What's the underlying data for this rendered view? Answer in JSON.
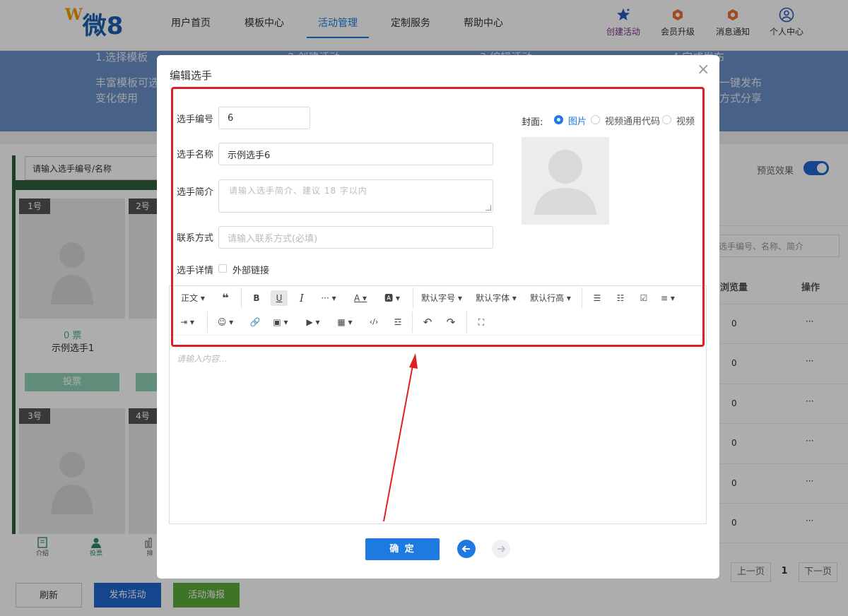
{
  "nav": {
    "logo_mark": "W",
    "logo_text": "微8",
    "items": [
      "用户首页",
      "模板中心",
      "活动管理",
      "定制服务",
      "帮助中心"
    ],
    "right": [
      "创建活动",
      "会员升级",
      "消息通知",
      "个人中心"
    ]
  },
  "banner": {
    "step1": "1.选择模板",
    "step2": "2.创建活动",
    "step3": "3.编辑活动",
    "step4": "4.完成发布",
    "desc_left_1": "丰富模板可选",
    "desc_left_2": "变化使用",
    "desc_right_1": "一键发布",
    "desc_right_2": "方式分享"
  },
  "background": {
    "search_placeholder": "请输入选手编号/名称",
    "cards": [
      {
        "num": "1号",
        "votes": "0 票",
        "name": "示例选手1",
        "vote_btn": "投票"
      },
      {
        "num": "2号"
      },
      {
        "num": "3号"
      },
      {
        "num": "4号"
      }
    ],
    "bottom_tabs": [
      "介绍",
      "投票",
      "排"
    ],
    "buttons": {
      "refresh": "刷新",
      "publish": "发布活动",
      "poster": "活动海报"
    },
    "preview_label": "预览效果",
    "table_search_placeholder": "选手编号、名称、简介",
    "columns": [
      "浏览量",
      "操作"
    ],
    "rows": [
      {
        "views": "0",
        "ops": "···"
      },
      {
        "views": "0",
        "ops": "···"
      },
      {
        "views": "0",
        "ops": "···"
      },
      {
        "views": "0",
        "ops": "···"
      },
      {
        "views": "0",
        "ops": "···"
      },
      {
        "views": "0",
        "ops": "···"
      }
    ],
    "pager": {
      "prev": "上一页",
      "page": "1",
      "next": "下一页"
    }
  },
  "modal": {
    "title": "编辑选手",
    "fields": {
      "number_label": "选手编号",
      "number_value": "6",
      "name_label": "选手名称",
      "name_value": "示例选手6",
      "intro_label": "选手简介",
      "intro_placeholder": "请输入选手简介、建议 18 字以内",
      "contact_label": "联系方式",
      "contact_placeholder": "请输入联系方式(必填)",
      "detail_label": "选手详情",
      "external_link_label": "外部链接"
    },
    "cover": {
      "label": "封面:",
      "options": [
        "图片",
        "视频通用代码",
        "视频"
      ],
      "selected": "图片"
    },
    "toolbar": {
      "paragraph": "正文",
      "font_size": "默认字号",
      "font_family": "默认字体",
      "line_height": "默认行高"
    },
    "editor_placeholder": "请输入内容...",
    "ok_button": "确 定"
  },
  "colors": {
    "accent": "#1e7ae0",
    "annotation": "#e02020",
    "banner": "#6b8fc7",
    "green": "#2f5e3a"
  }
}
